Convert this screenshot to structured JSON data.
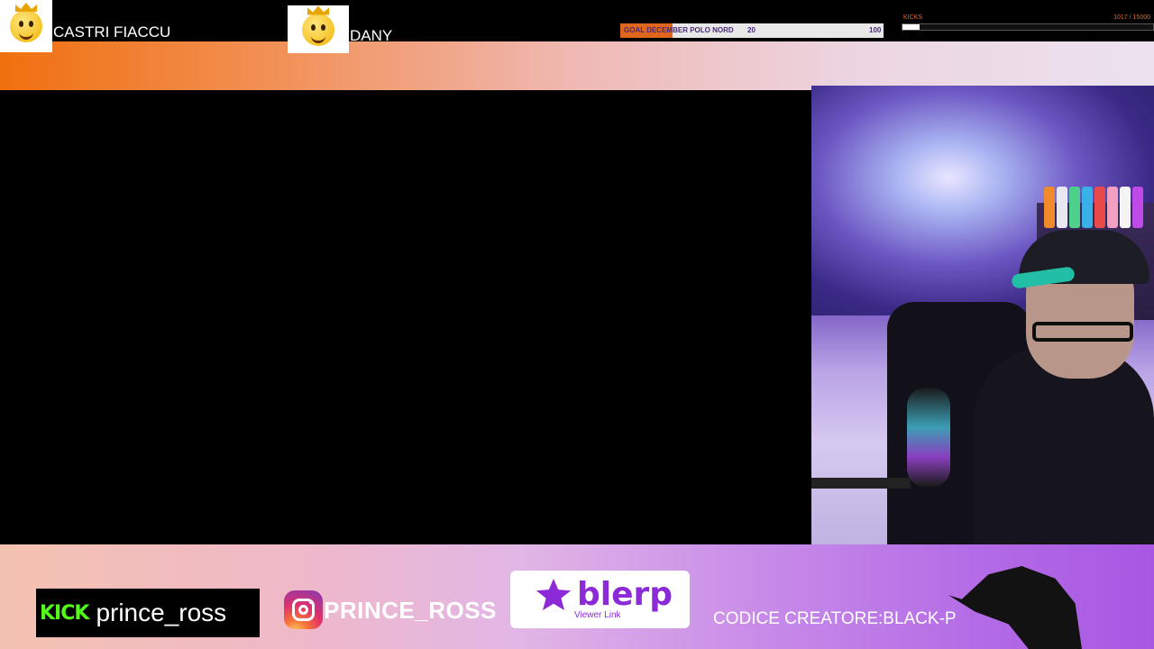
{
  "top_users": [
    {
      "name": "CASTRI FIACCU",
      "avatar_icon": "king-emoji-icon"
    },
    {
      "name": "DANY",
      "avatar_icon": "crowned-emoji-icon"
    }
  ],
  "goal": {
    "label": "GOAL DECEMBER POLO NORD",
    "current": "20",
    "target": "100",
    "progress": 0.2,
    "fill_color": "#e0661b"
  },
  "kicks": {
    "label": "KICKS",
    "value_text": "1017  / 15000",
    "progress": 0.0678
  },
  "socials": {
    "kick_logo": "KICK",
    "kick_handle": "prince_ross",
    "instagram_handle": "PRINCE_ROSS",
    "blerp_name": "blerp",
    "blerp_sub": "Viewer Link",
    "creator_code": "CODICE CREATORE:BLACK-P"
  },
  "colors": {
    "kick_green": "#53fc18",
    "blerp_purple": "#8b2ad6",
    "accent_orange": "#f0700f"
  }
}
